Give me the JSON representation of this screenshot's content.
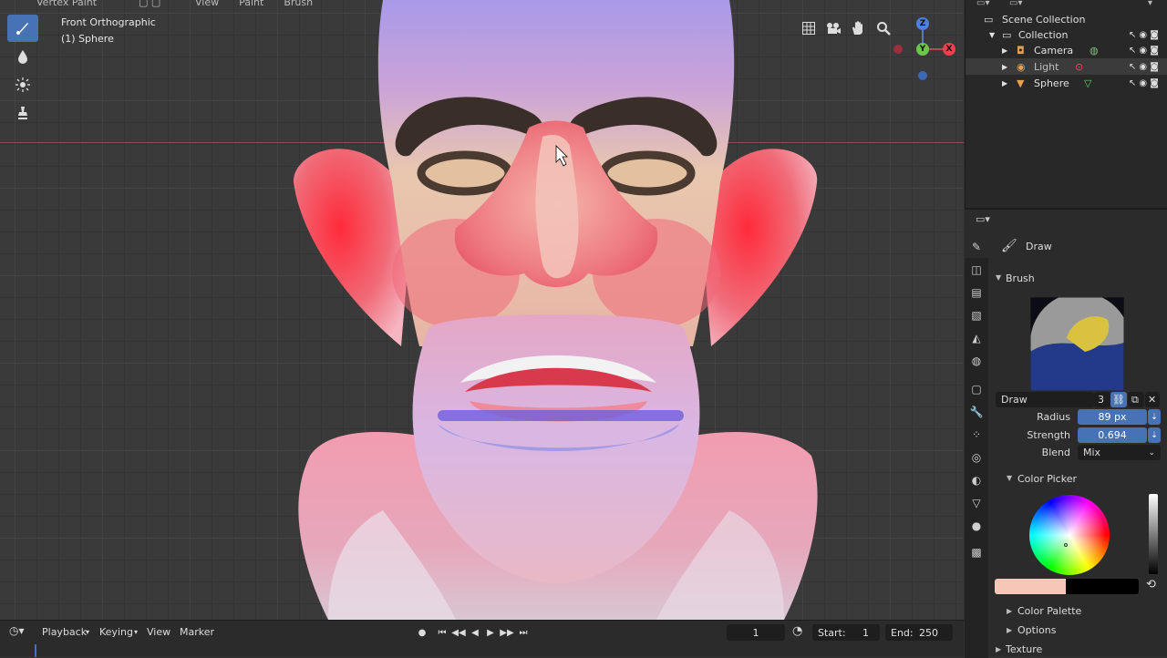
{
  "header_menu": {
    "mode": "Vertex Paint",
    "items": [
      "View",
      "Paint",
      "Brush"
    ]
  },
  "viewport": {
    "view_name": "Front Orthographic",
    "object_name": "(1) Sphere"
  },
  "tools": [
    "brush-icon",
    "drop-icon",
    "sparkle-icon",
    "stamp-icon"
  ],
  "gizmo": {
    "z": "Z",
    "y": "Y",
    "x": "X"
  },
  "outliner": {
    "root": "Scene Collection",
    "collection": "Collection",
    "objects": [
      "Camera",
      "Light",
      "Sphere"
    ]
  },
  "properties": {
    "tool_name": "Draw",
    "brush_section": "Brush",
    "brush_name": "Draw",
    "brush_users": "3",
    "radius_label": "Radius",
    "radius_value": "89 px",
    "strength_label": "Strength",
    "strength_value": "0.694",
    "blend_label": "Blend",
    "blend_value": "Mix",
    "color_picker": "Color Picker",
    "color_palette": "Color Palette",
    "options": "Options",
    "texture": "Texture",
    "brush_color": "#f6c7b8"
  },
  "timeline": {
    "menus": [
      "Playback",
      "Keying",
      "View",
      "Marker"
    ],
    "current_frame": "1",
    "start_label": "Start:",
    "start_value": "1",
    "end_label": "End:",
    "end_value": "250"
  }
}
